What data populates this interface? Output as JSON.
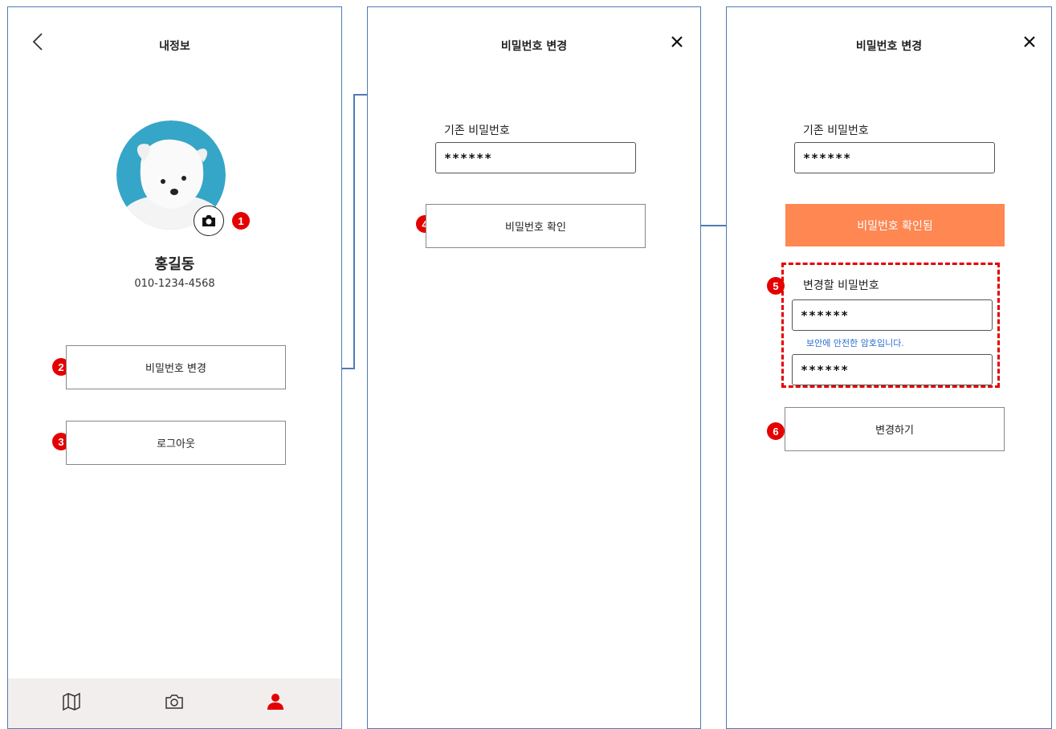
{
  "screen1": {
    "title": "내정보",
    "profile": {
      "name": "홍길동",
      "phone": "010-1234-4568"
    },
    "buttons": {
      "change_password": "비밀번호 변경",
      "logout": "로그아웃"
    },
    "markers": [
      "1",
      "2",
      "3"
    ],
    "tabbar": {
      "icons": [
        "map-icon",
        "camera-icon",
        "user-icon"
      ],
      "active": "user-icon",
      "active_color": "#e40000"
    }
  },
  "screen2": {
    "title": "비밀번호 변경",
    "current_password_label": "기존 비밀번호",
    "current_password_value": "******",
    "verify_button": "비밀번호 확인",
    "marker": "4"
  },
  "screen3": {
    "title": "비밀번호 변경",
    "current_password_label": "기존 비밀번호",
    "current_password_value": "******",
    "verified_button": "비밀번호 확인됨",
    "new_password_label": "변경할 비밀번호",
    "new_password_value": "******",
    "strength_hint": "보안에 안전한 암호입니다.",
    "confirm_password_value": "******",
    "submit_button": "변경하기",
    "markers": [
      "5",
      "6"
    ]
  },
  "colors": {
    "panel_border": "#4f7bb5",
    "marker": "#e40000",
    "accent_orange": "#ff8752",
    "hint_blue": "#2a6fd0",
    "connector": "#4f7bb5",
    "avatar_bg": "#35a6c7"
  }
}
